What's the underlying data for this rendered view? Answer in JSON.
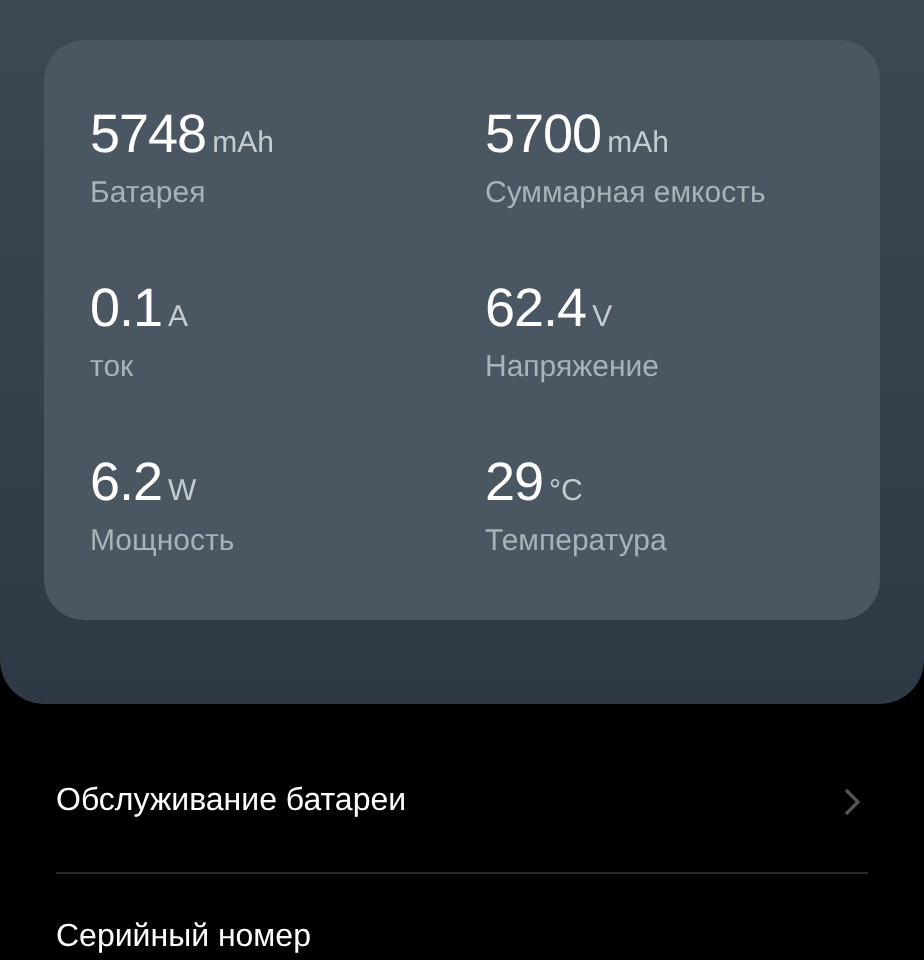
{
  "stats": [
    {
      "value": "5748",
      "unit": "mAh",
      "label": "Батарея"
    },
    {
      "value": "5700",
      "unit": "mAh",
      "label": "Суммарная емкость"
    },
    {
      "value": "0.1",
      "unit": "A",
      "label": "ток"
    },
    {
      "value": "62.4",
      "unit": "V",
      "label": "Напряжение"
    },
    {
      "value": "6.2",
      "unit": "W",
      "label": "Мощность"
    },
    {
      "value": "29",
      "unit": "°C",
      "label": "Температура"
    }
  ],
  "menu": [
    {
      "label": "Обслуживание батареи",
      "kind": "link"
    },
    {
      "label": "Серийный номер",
      "kind": "plain"
    }
  ]
}
